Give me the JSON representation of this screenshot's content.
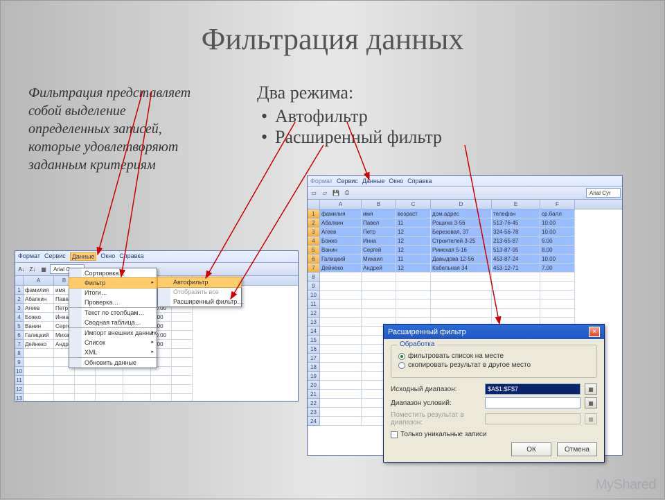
{
  "title": "Фильтрация данных",
  "intro": "Фильтрация представляет собой выделение определенных записей, которые удовлетворяют заданным критериям",
  "modes": {
    "heading": "Два режима:",
    "items": [
      "Автофильтр",
      "Расширенный фильтр"
    ]
  },
  "menubar": [
    "Формат",
    "Сервис",
    "Данные",
    "Окно",
    "Справка"
  ],
  "font_name": "Arial Cyr",
  "columns": [
    "A",
    "B",
    "C",
    "D",
    "E",
    "F"
  ],
  "table": {
    "headers": [
      "фамилия",
      "имя",
      "возраст",
      "дом.адрес",
      "телефон",
      "ср.балл"
    ],
    "rows": [
      [
        "Абалкин",
        "Павел",
        "11",
        "Рощина 3-56",
        "513-76-45",
        "10.00"
      ],
      [
        "Агеев",
        "Петр",
        "12",
        "Березовая, 37",
        "324-56-78",
        "10.00"
      ],
      [
        "Божко",
        "Инна",
        "12",
        "Строителей 3-25",
        "213-65-87",
        "9.00"
      ],
      [
        "Ванин",
        "Сергей",
        "12",
        "Римская 5-16",
        "513-87-95",
        "8.00"
      ],
      [
        "Галицкий",
        "Михаил",
        "11",
        "Давыдова 12-56",
        "453-87-24",
        "10.00"
      ],
      [
        "Дейнеко",
        "Андрей",
        "12",
        "Кабельная 34",
        "453-12-71",
        "7.00"
      ]
    ]
  },
  "data_menu": {
    "sort": "Сортировка…",
    "filter": "Фильтр",
    "totals": "Итоги…",
    "validate": "Проверка…",
    "text_to_cols": "Текст по столбцам…",
    "pivot": "Сводная таблица…",
    "import": "Импорт внешних данных",
    "list": "Список",
    "xml": "XML",
    "refresh": "Обновить данные"
  },
  "filter_submenu": {
    "autofilter": "Автофильтр",
    "show_all": "Отобразить все",
    "advanced": "Расширенный фильтр…"
  },
  "dialog": {
    "title": "Расширенный фильтр",
    "group": "Обработка",
    "radio_inplace": "фильтровать список на месте",
    "radio_copy": "скопировать результат в другое место",
    "src_range": "Исходный диапазон:",
    "src_value": "$A$1:$F$7",
    "crit_range": "Диапазон условий:",
    "copy_to": "Поместить результат в диапазон:",
    "unique": "Только уникальные записи",
    "ok": "ОК",
    "cancel": "Отмена"
  },
  "watermark": "MyShared"
}
